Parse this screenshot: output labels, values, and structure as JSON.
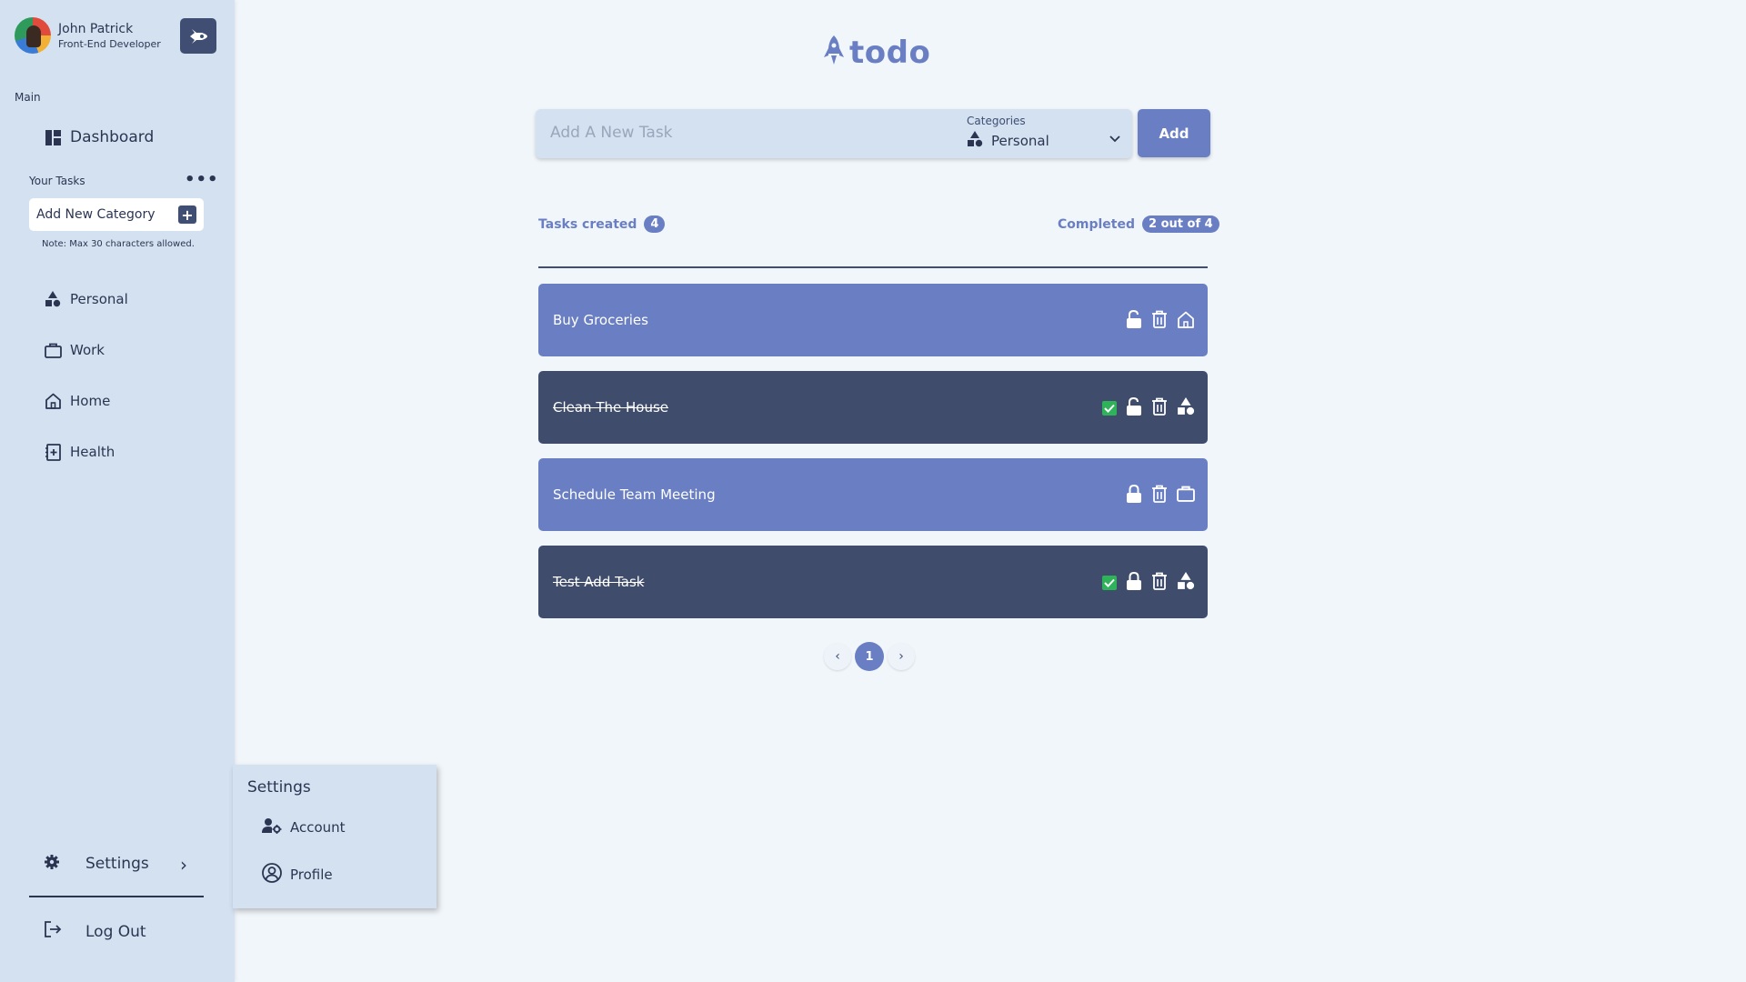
{
  "user": {
    "name": "John Patrick",
    "role": "Front-End Developer"
  },
  "sidebar": {
    "main_label": "Main",
    "dashboard_label": "Dashboard",
    "your_tasks_label": "Your Tasks",
    "add_category_placeholder": "Add New Category",
    "category_note": "Note: Max 30 characters allowed.",
    "categories": [
      {
        "label": "Personal",
        "icon": "shapes-icon"
      },
      {
        "label": "Work",
        "icon": "briefcase-icon"
      },
      {
        "label": "Home",
        "icon": "home-icon"
      },
      {
        "label": "Health",
        "icon": "health-journal-icon"
      }
    ],
    "settings_label": "Settings",
    "logout_label": "Log Out"
  },
  "settings_menu": {
    "title": "Settings",
    "items": [
      {
        "label": "Account",
        "icon": "user-gear-icon"
      },
      {
        "label": "Profile",
        "icon": "user-circle-icon"
      }
    ]
  },
  "brand": {
    "name": "todo"
  },
  "task_form": {
    "placeholder": "Add A New Task",
    "categories_label": "Categories",
    "selected_category": "Personal",
    "add_label": "Add"
  },
  "stats": {
    "created_label": "Tasks created",
    "created_count": "4",
    "completed_label": "Completed",
    "completed_value": "2 out of 4"
  },
  "tasks": [
    {
      "name": "Buy Groceries",
      "completed": false,
      "locked": false,
      "category_icon": "home-icon"
    },
    {
      "name": "Clean The House",
      "completed": true,
      "locked": false,
      "category_icon": "shapes-icon"
    },
    {
      "name": "Schedule Team Meeting",
      "completed": false,
      "locked": true,
      "category_icon": "briefcase-icon"
    },
    {
      "name": "Test Add Task",
      "completed": true,
      "locked": true,
      "category_icon": "shapes-icon"
    }
  ],
  "pagination": {
    "prev": "‹",
    "current": "1",
    "next": "›"
  },
  "colors": {
    "accent": "#6a7fc3",
    "dark": "#3f4c6b",
    "sidebar": "#d3e1f1",
    "background": "#f1f6fb",
    "check": "#2fb35a"
  }
}
